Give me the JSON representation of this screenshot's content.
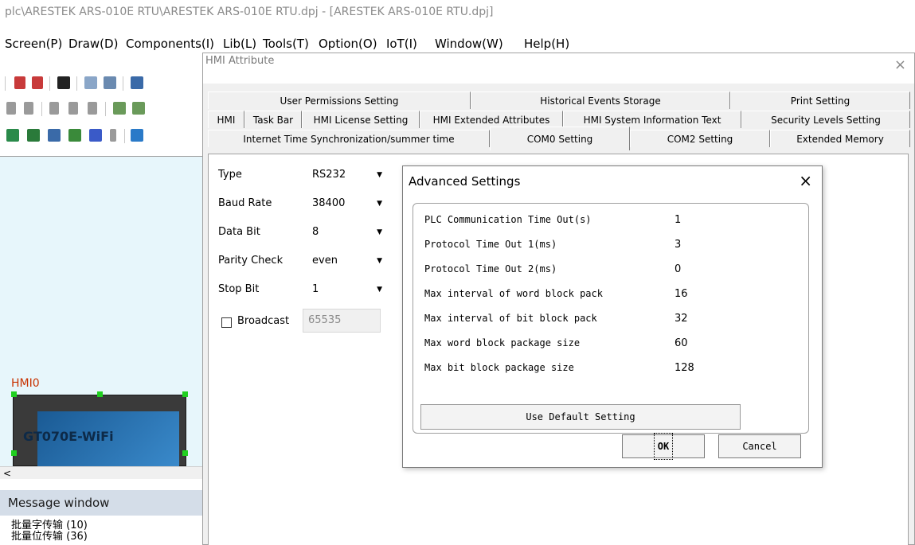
{
  "window": {
    "title": "plc\\ARESTEK ARS-010E RTU\\ARESTEK ARS-010E RTU.dpj - [ARESTEK ARS-010E RTU.dpj]"
  },
  "menubar": {
    "items": [
      {
        "label": "Screen(P)"
      },
      {
        "label": "Draw(D)"
      },
      {
        "label": "Components(I)"
      },
      {
        "label": "Lib(L)"
      },
      {
        "label": "Tools(T)"
      },
      {
        "label": "Option(O)"
      },
      {
        "label": "IoT(I)"
      },
      {
        "label": "Window(W)"
      },
      {
        "label": "Help(H)"
      }
    ]
  },
  "toolbar": {
    "icons": [
      "undo-icon",
      "redo-icon",
      "find-icon",
      "print-preview-icon",
      "print-icon",
      "image-icon",
      "align-icon",
      "grid-icon",
      "layer-icon",
      "screen-icon",
      "folder-icon",
      "hmi-icon",
      "tools-icon",
      "robot-icon",
      "dropdown-icon",
      "transfer-icon"
    ]
  },
  "canvas": {
    "hmi_label": "HMI0",
    "device_label": "GT070E-WiFi",
    "scroll_left": "<"
  },
  "message_window": {
    "title": "Message window",
    "lines": [
      "批量字传输 (10)",
      "批量位传输 (36)"
    ]
  },
  "hmi_dialog": {
    "title": "HMI Attribute",
    "close": "×",
    "tabs_row1": [
      "User Permissions Setting",
      "Historical Events Storage",
      "Print Setting"
    ],
    "tabs_row2": [
      "HMI",
      "Task Bar",
      "HMI License Setting",
      "HMI Extended Attributes",
      "HMI System Information Text",
      "Security Levels Setting"
    ],
    "tabs_row3": [
      "Internet Time Synchronization/summer time",
      "COM0 Setting",
      "COM2 Setting",
      "Extended Memory"
    ],
    "active_tab": "COM0 Setting",
    "fields": [
      {
        "label": "Type",
        "value": "RS232"
      },
      {
        "label": "Baud Rate",
        "value": "38400"
      },
      {
        "label": "Data Bit",
        "value": "8"
      },
      {
        "label": "Parity Check",
        "value": "even"
      },
      {
        "label": "Stop Bit",
        "value": "1"
      }
    ],
    "broadcast": {
      "label": "Broadcast",
      "checked": false,
      "value": "65535"
    }
  },
  "advanced_dialog": {
    "title": "Advanced Settings",
    "close": "×",
    "rows": [
      {
        "label": "PLC Communication Time Out(s)",
        "value": "1"
      },
      {
        "label": "Protocol Time Out 1(ms)",
        "value": "3"
      },
      {
        "label": "Protocol Time Out 2(ms)",
        "value": "0"
      },
      {
        "label": "Max interval of word block pack",
        "value": "16"
      },
      {
        "label": "Max interval of bit block pack",
        "value": "32"
      },
      {
        "label": "Max word block package size",
        "value": "60"
      },
      {
        "label": "Max bit block package size",
        "value": "128"
      }
    ],
    "default_button": "Use Default Setting",
    "ok_button": "OK",
    "cancel_button": "Cancel"
  }
}
